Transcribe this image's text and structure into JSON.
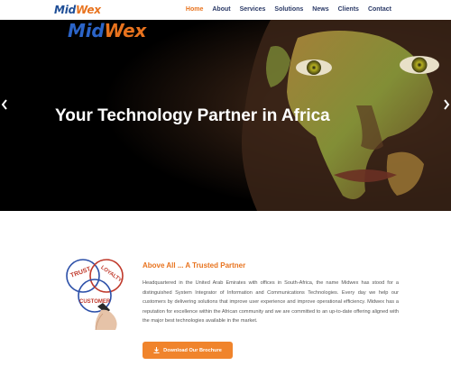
{
  "brand": {
    "part1": "Mid",
    "part2": "Wex"
  },
  "nav": [
    {
      "label": "Home",
      "active": true
    },
    {
      "label": "About",
      "active": false
    },
    {
      "label": "Services",
      "active": false
    },
    {
      "label": "Solutions",
      "active": false
    },
    {
      "label": "News",
      "active": false
    },
    {
      "label": "Clients",
      "active": false
    },
    {
      "label": "Contact",
      "active": false
    }
  ],
  "hero": {
    "title": "Your Technology Partner in Africa",
    "prev_icon": "chevron-left",
    "next_icon": "chevron-right"
  },
  "intro": {
    "title": "Above All ... A Trusted Partner",
    "body": "Headquartered in the United Arab Emirates with offices in South-Africa, the name Midwex has stood for a distinguished System Integrator of Information and Communications Technologies. Every day we help our customers by delivering solutions that improve user experience and improve operational efficiency. Midwex has a reputation for excellence within the African community and we are committed to an up-to-date offering aligned with the major best technologies available in the market.",
    "graphic_words": [
      "TRUST",
      "LOYALTY",
      "CUSTOMER"
    ],
    "button_label": "Download Our Brochure",
    "button_icon": "download-icon"
  },
  "colors": {
    "accent": "#e8731e",
    "navy": "#2b3a67",
    "button": "#f0842c"
  }
}
